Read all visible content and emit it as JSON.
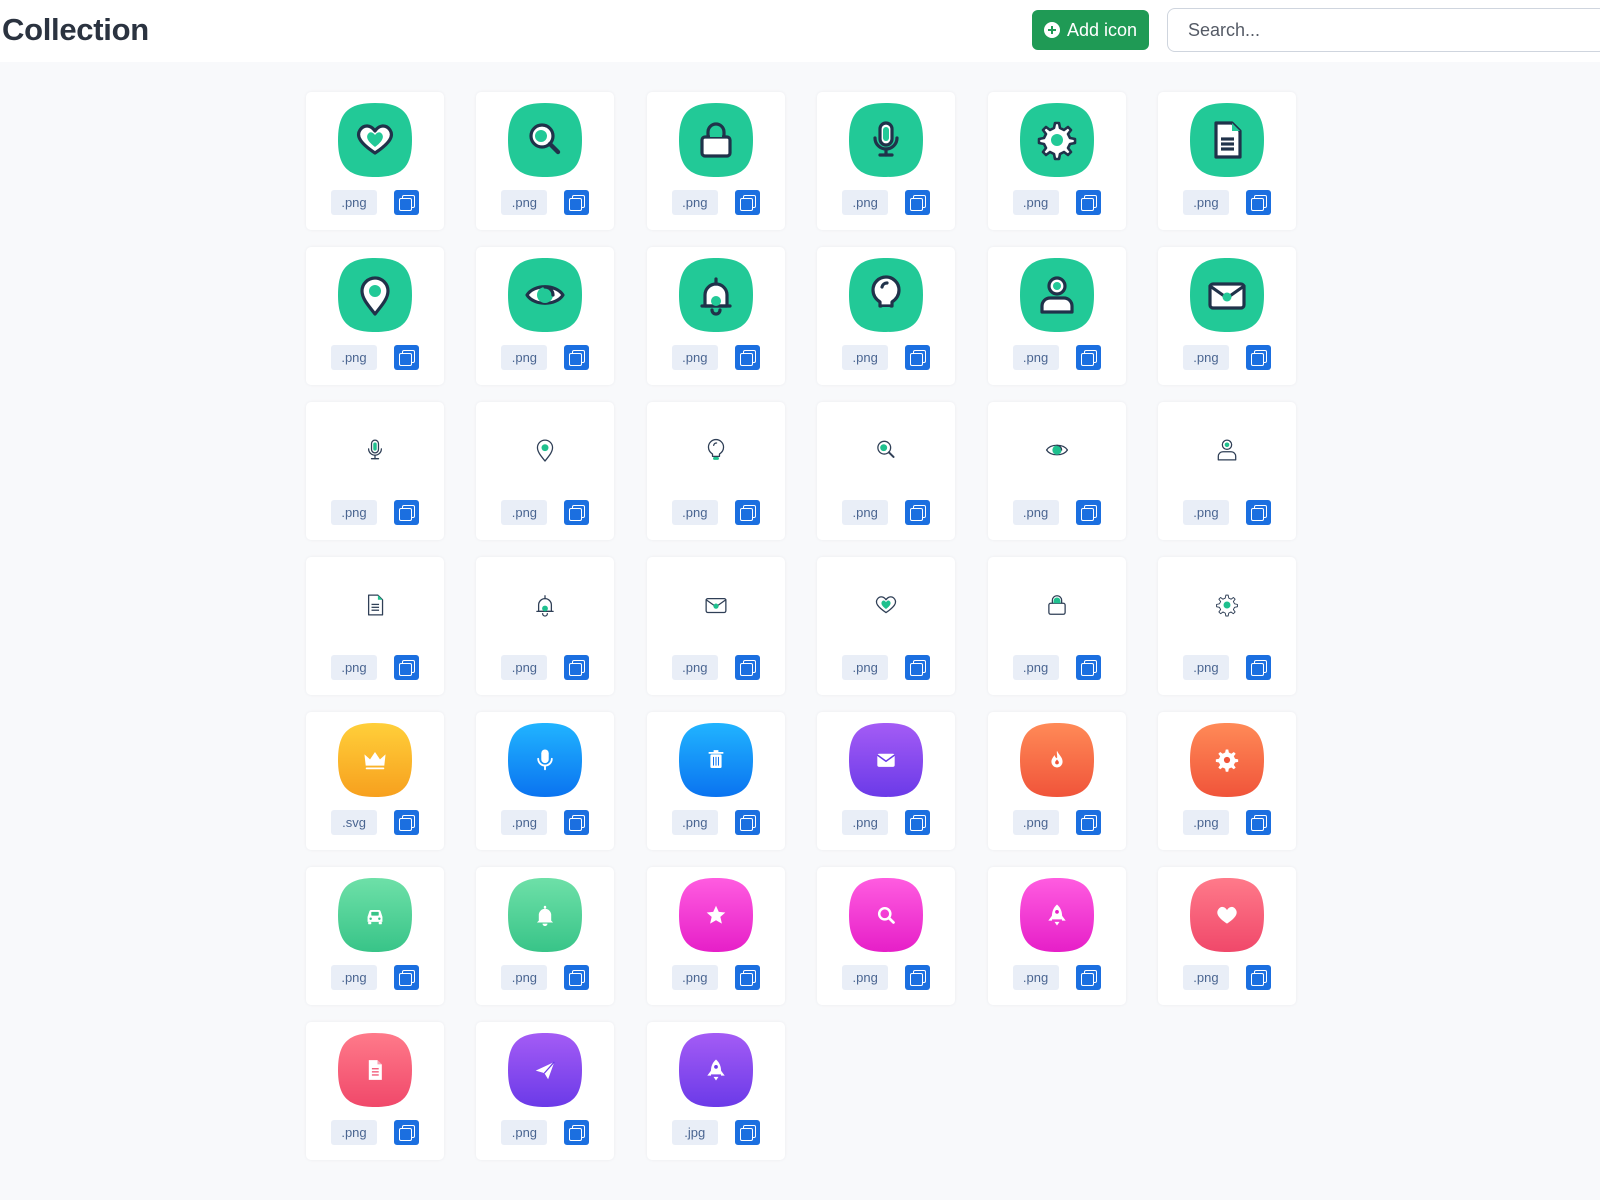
{
  "header": {
    "title": "Collection",
    "add_button_label": "Add icon",
    "search_placeholder": "Search..."
  },
  "icons": [
    {
      "name": "heart",
      "style": "solid-green",
      "ext": ".png"
    },
    {
      "name": "search",
      "style": "solid-green",
      "ext": ".png"
    },
    {
      "name": "lock",
      "style": "solid-green",
      "ext": ".png"
    },
    {
      "name": "microphone",
      "style": "solid-green",
      "ext": ".png"
    },
    {
      "name": "gear",
      "style": "solid-green",
      "ext": ".png"
    },
    {
      "name": "document",
      "style": "solid-green",
      "ext": ".png"
    },
    {
      "name": "location-pin",
      "style": "solid-green",
      "ext": ".png"
    },
    {
      "name": "eye",
      "style": "solid-green",
      "ext": ".png"
    },
    {
      "name": "bell",
      "style": "solid-green",
      "ext": ".png"
    },
    {
      "name": "lightbulb",
      "style": "solid-green",
      "ext": ".png"
    },
    {
      "name": "user",
      "style": "solid-green",
      "ext": ".png"
    },
    {
      "name": "envelope",
      "style": "solid-green",
      "ext": ".png"
    },
    {
      "name": "microphone",
      "style": "outline",
      "ext": ".png"
    },
    {
      "name": "location-pin",
      "style": "outline",
      "ext": ".png"
    },
    {
      "name": "lightbulb",
      "style": "outline",
      "ext": ".png"
    },
    {
      "name": "search",
      "style": "outline",
      "ext": ".png"
    },
    {
      "name": "eye",
      "style": "outline",
      "ext": ".png"
    },
    {
      "name": "user",
      "style": "outline",
      "ext": ".png"
    },
    {
      "name": "document",
      "style": "outline",
      "ext": ".png"
    },
    {
      "name": "bell",
      "style": "outline",
      "ext": ".png"
    },
    {
      "name": "envelope",
      "style": "outline",
      "ext": ".png"
    },
    {
      "name": "heart",
      "style": "outline",
      "ext": ".png"
    },
    {
      "name": "lock",
      "style": "outline",
      "ext": ".png"
    },
    {
      "name": "gear",
      "style": "outline",
      "ext": ".png"
    },
    {
      "name": "crown",
      "style": "gradient",
      "colors": [
        "#ffcf3a",
        "#f7a01e"
      ],
      "ext": ".svg"
    },
    {
      "name": "microphone",
      "style": "gradient",
      "colors": [
        "#21b4ff",
        "#0a73f0"
      ],
      "ext": ".png"
    },
    {
      "name": "trash",
      "style": "gradient",
      "colors": [
        "#21b4ff",
        "#0a73f0"
      ],
      "ext": ".png"
    },
    {
      "name": "envelope",
      "style": "gradient",
      "colors": [
        "#a45cf5",
        "#6b3ae8"
      ],
      "ext": ".png"
    },
    {
      "name": "flame",
      "style": "gradient",
      "colors": [
        "#ff8a57",
        "#f0543a"
      ],
      "ext": ".png"
    },
    {
      "name": "gear",
      "style": "gradient",
      "colors": [
        "#ff8a57",
        "#f0543a"
      ],
      "ext": ".png"
    },
    {
      "name": "car",
      "style": "gradient",
      "colors": [
        "#6ee0a8",
        "#38c488"
      ],
      "ext": ".png"
    },
    {
      "name": "bell",
      "style": "gradient",
      "colors": [
        "#6ee0a8",
        "#38c488"
      ],
      "ext": ".png"
    },
    {
      "name": "star",
      "style": "gradient",
      "colors": [
        "#ff5ce0",
        "#e61fc8"
      ],
      "ext": ".png"
    },
    {
      "name": "search",
      "style": "gradient",
      "colors": [
        "#ff5ce0",
        "#e61fc8"
      ],
      "ext": ".png"
    },
    {
      "name": "rocket",
      "style": "gradient",
      "colors": [
        "#ff5ce0",
        "#e61fc8"
      ],
      "ext": ".png"
    },
    {
      "name": "heart",
      "style": "gradient",
      "colors": [
        "#ff7a8a",
        "#f0486a"
      ],
      "ext": ".png"
    },
    {
      "name": "document",
      "style": "gradient",
      "colors": [
        "#ff7a8a",
        "#f0486a"
      ],
      "ext": ".png"
    },
    {
      "name": "paper-plane",
      "style": "gradient",
      "colors": [
        "#a45cf5",
        "#6b3ae8"
      ],
      "ext": ".png"
    },
    {
      "name": "rocket",
      "style": "gradient",
      "colors": [
        "#a45cf5",
        "#6b3ae8"
      ],
      "ext": ".jpg"
    }
  ],
  "colors": {
    "green_bg": "#22c997",
    "green_dark": "#20324a",
    "outline_stroke": "#2f3f56",
    "accent_green": "#1fc08e"
  }
}
